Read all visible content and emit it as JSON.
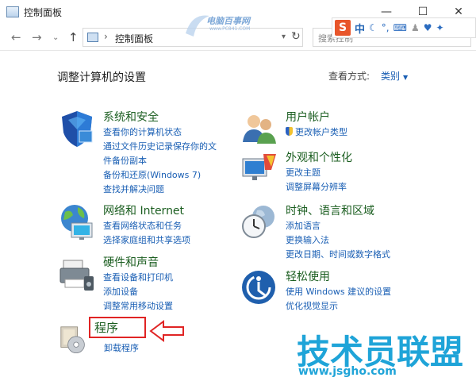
{
  "window": {
    "title": "控制面板",
    "min": "—",
    "max": "☐",
    "close": "✕"
  },
  "toolbar": {
    "back": "←",
    "forward": "→",
    "recent": "⌄",
    "up": "↑",
    "address_sep": "›",
    "address_crumb": "控制面板",
    "refresh": "↻",
    "search_placeholder": "搜索控制"
  },
  "watermark": {
    "text": "电脑百事网",
    "url": "www.PC841.COM"
  },
  "ime": {
    "logo": "S",
    "lang": "中"
  },
  "main": {
    "heading": "调整计算机的设置",
    "view_by_label": "查看方式:",
    "view_by_value": "类别"
  },
  "categories": {
    "system_security": {
      "title": "系统和安全",
      "links": [
        "查看你的计算机状态",
        "通过文件历史记录保存你的文",
        "件备份副本",
        "备份和还原(Windows 7)",
        "查找并解决问题"
      ]
    },
    "network": {
      "title": "网络和 Internet",
      "links": [
        "查看网络状态和任务",
        "选择家庭组和共享选项"
      ]
    },
    "hardware": {
      "title": "硬件和声音",
      "links": [
        "查看设备和打印机",
        "添加设备",
        "调整常用移动设置"
      ]
    },
    "programs": {
      "title": "程序",
      "links": [
        "卸载程序"
      ]
    },
    "user_accounts": {
      "title": "用户帐户",
      "links": [
        "更改帐户类型"
      ]
    },
    "appearance": {
      "title": "外观和个性化",
      "links": [
        "更改主题",
        "调整屏幕分辨率"
      ]
    },
    "clock_region": {
      "title": "时钟、语言和区域",
      "links": [
        "添加语言",
        "更换输入法",
        "更改日期、时间或数字格式"
      ]
    },
    "ease_access": {
      "title": "轻松使用",
      "links": [
        "使用 Windows 建议的设置",
        "优化视觉显示"
      ]
    }
  },
  "brand": {
    "text": "技术员联盟",
    "url": "www.jsgho.com"
  },
  "colors": {
    "link": "#1a5fb4",
    "category_title": "#1b5e20",
    "highlight": "#e02424",
    "brand": "#1fa4d8"
  }
}
